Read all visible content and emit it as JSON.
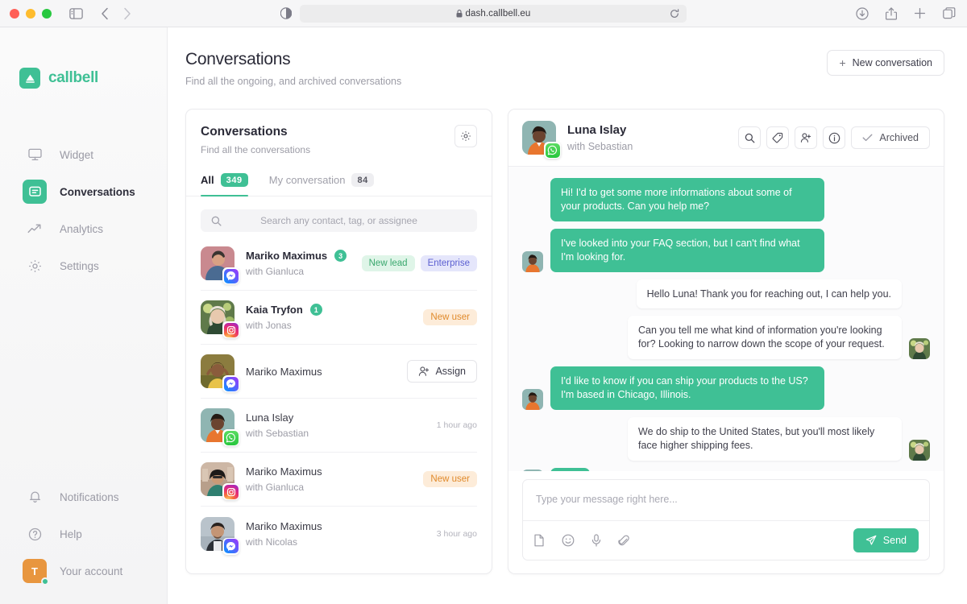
{
  "browser": {
    "url": "dash.callbell.eu",
    "lock_icon": "lock-icon",
    "reload_icon": "reload-icon",
    "sidebar_toggle_icon": "sidebar-toggle-icon",
    "back_icon": "back-arrow-icon",
    "forward_icon": "forward-arrow-icon",
    "reader_icon": "reader-view-icon",
    "download_icon": "download-icon",
    "share_icon": "share-icon",
    "new_tab_icon": "plus-icon",
    "tab_overview_icon": "tab-overview-icon"
  },
  "sidebar": {
    "brand": "callbell",
    "brand_icon": "callbell-logo-icon",
    "accent": "#3fc095",
    "items": [
      {
        "label": "Widget",
        "icon": "monitor-icon",
        "active": false
      },
      {
        "label": "Conversations",
        "icon": "chat-bubble-icon",
        "active": true
      },
      {
        "label": "Analytics",
        "icon": "trending-up-icon",
        "active": false
      },
      {
        "label": "Settings",
        "icon": "gear-icon",
        "active": false
      }
    ],
    "bottom": [
      {
        "label": "Notifications",
        "icon": "bell-icon"
      },
      {
        "label": "Help",
        "icon": "question-circle-icon"
      }
    ],
    "account": {
      "label": "Your account",
      "initial": "T",
      "avatar_color": "#e8963f",
      "presence_color": "#3fc095"
    }
  },
  "page": {
    "title": "Conversations",
    "subtitle": "Find all the ongoing, and archived conversations",
    "new_conversation_label": "New conversation"
  },
  "list_panel": {
    "title": "Conversations",
    "subtitle": "Find all the conversations",
    "settings_icon": "gear-icon",
    "tabs": [
      {
        "label": "All",
        "count": "349",
        "active": true
      },
      {
        "label": "My conversation",
        "count": "84",
        "active": false
      }
    ],
    "search": {
      "placeholder": "Search any contact, tag, or assignee",
      "value": "",
      "icon": "search-icon"
    },
    "rows": [
      {
        "name": "Mariko Maximus",
        "with": "with Gianluca",
        "channel": "messenger",
        "unread": "3",
        "tags": [
          {
            "text": "New lead",
            "style": "lead"
          },
          {
            "text": "Enterprise",
            "style": "ent"
          }
        ],
        "time": "",
        "assign": ""
      },
      {
        "name": "Kaia Tryfon",
        "with": "with Jonas",
        "channel": "instagram",
        "unread": "1",
        "tags": [
          {
            "text": "New user",
            "style": "newuser"
          }
        ],
        "time": "",
        "assign": ""
      },
      {
        "name": "Mariko Maximus",
        "with": "",
        "channel": "messenger",
        "unread": "",
        "tags": [],
        "time": "",
        "assign": "Assign"
      },
      {
        "name": "Luna Islay",
        "with": "with Sebastian",
        "channel": "whatsapp",
        "unread": "",
        "tags": [],
        "time": "1 hour ago",
        "assign": ""
      },
      {
        "name": "Mariko Maximus",
        "with": "with Gianluca",
        "channel": "instagram",
        "unread": "",
        "tags": [
          {
            "text": "New user",
            "style": "newuser"
          }
        ],
        "time": "",
        "assign": ""
      },
      {
        "name": "Mariko Maximus",
        "with": "with Nicolas",
        "channel": "messenger",
        "unread": "",
        "tags": [],
        "time": "3 hour ago",
        "assign": ""
      }
    ]
  },
  "chat": {
    "contact_name": "Luna Islay",
    "contact_with": "with Sebastian",
    "channel": "whatsapp",
    "actions": [
      {
        "icon": "search-icon",
        "label": ""
      },
      {
        "icon": "tag-icon",
        "label": ""
      },
      {
        "icon": "add-user-icon",
        "label": ""
      },
      {
        "icon": "info-icon",
        "label": ""
      }
    ],
    "archived_label": "Archived",
    "archived_icon": "check-icon",
    "messages": [
      {
        "dir": "in",
        "text": "Hi! I'd to get some more informations about some of your products. Can you help me?",
        "avatar": false
      },
      {
        "dir": "in",
        "text": "I've looked into your FAQ section, but I can't find what I'm looking for.",
        "avatar": true
      },
      {
        "dir": "out",
        "text": "Hello Luna! Thank you for reaching out, I can help you.",
        "avatar": false
      },
      {
        "dir": "out",
        "text": "Can you tell me what kind of information you're looking for? Looking to narrow down the scope of your request.",
        "avatar": true
      },
      {
        "dir": "in",
        "text": "I'd like to know if you can ship your products to the US? I'm based in Chicago, Illinois.",
        "avatar": true
      },
      {
        "dir": "out",
        "text": "We do ship to the United States, but you'll most likely face higher shipping fees.",
        "avatar": true
      }
    ],
    "typing_indicator": true,
    "composer": {
      "placeholder": "Type your message right here...",
      "value": "",
      "tools": [
        {
          "icon": "document-icon"
        },
        {
          "icon": "emoji-icon"
        },
        {
          "icon": "microphone-icon"
        },
        {
          "icon": "paperclip-icon"
        }
      ],
      "send_label": "Send",
      "send_icon": "send-paper-plane-icon"
    }
  }
}
